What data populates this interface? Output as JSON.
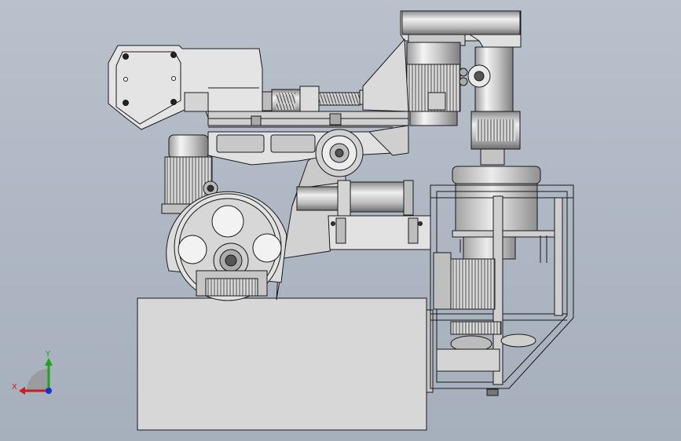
{
  "viewport": {
    "background_top": "#b9c1cc",
    "background_bottom": "#a6afbc"
  },
  "part_fill_light": "#e6e6e6",
  "part_fill_mid": "#cfcfcf",
  "part_fill_dark": "#8c8c8c",
  "triad": {
    "x_label": "X",
    "y_label": "Y",
    "x_color": "#d21a1a",
    "y_color": "#1ea41e",
    "z_color": "#1a2fd2"
  }
}
